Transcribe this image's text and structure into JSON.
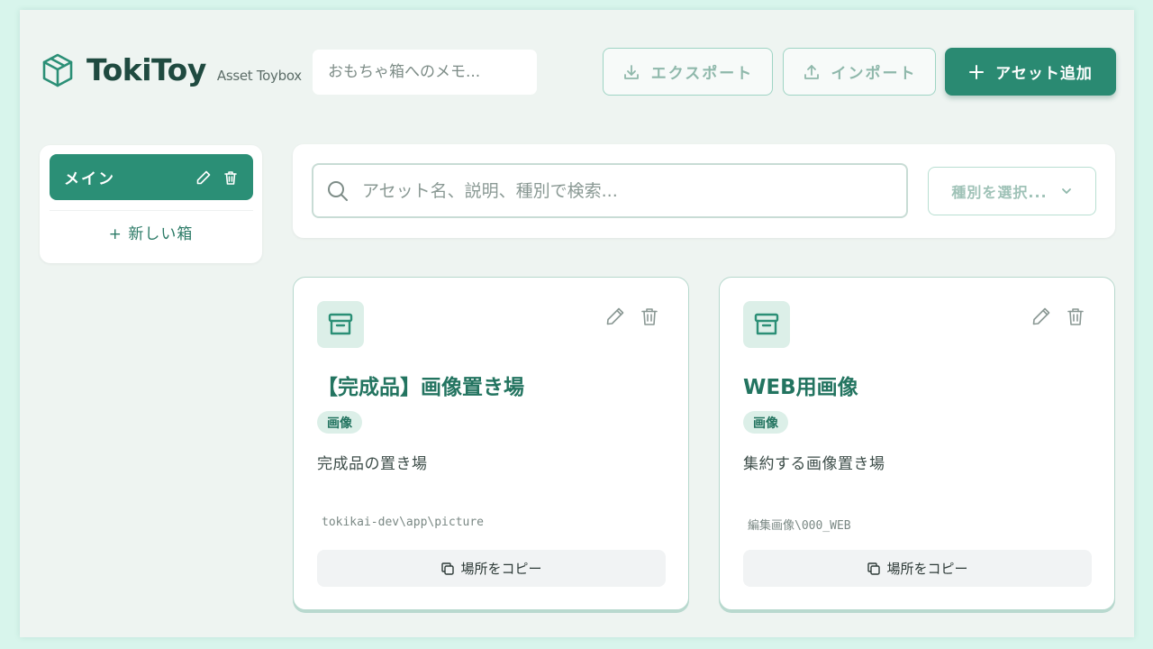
{
  "app": {
    "name": "TokiToy",
    "subtitle": "Asset Toybox"
  },
  "header": {
    "memo_placeholder": "おもちゃ箱へのメモ...",
    "export_label": "エクスポート",
    "import_label": "インポート",
    "add_asset_label": "アセット追加"
  },
  "sidebar": {
    "boxes": [
      {
        "label": "メイン",
        "active": true
      }
    ],
    "new_box_label": "+ 新しい箱"
  },
  "search": {
    "placeholder": "アセット名、説明、種別で検索...",
    "type_select_label": "種別を選択..."
  },
  "assets": [
    {
      "title": "【完成品】画像置き場",
      "type": "画像",
      "description": "完成品の置き場",
      "path": "tokikai-dev\\app\\picture",
      "copy_label": "場所をコピー"
    },
    {
      "title": "WEB用画像",
      "type": "画像",
      "description": "集約する画像置き場",
      "path": "編集画像\\000_WEB",
      "copy_label": "場所をコピー"
    }
  ],
  "colors": {
    "accent": "#2b8f76",
    "background": "#eef4f1",
    "outer": "#d8f5ec"
  },
  "icons": {
    "logo": "box-icon",
    "export": "download-icon",
    "import": "upload-icon",
    "add": "plus-icon",
    "edit": "pencil-icon",
    "delete": "trash-icon",
    "search": "search-icon",
    "dropdown": "chevron-down-icon",
    "asset": "archive-icon",
    "copy": "copy-icon"
  }
}
